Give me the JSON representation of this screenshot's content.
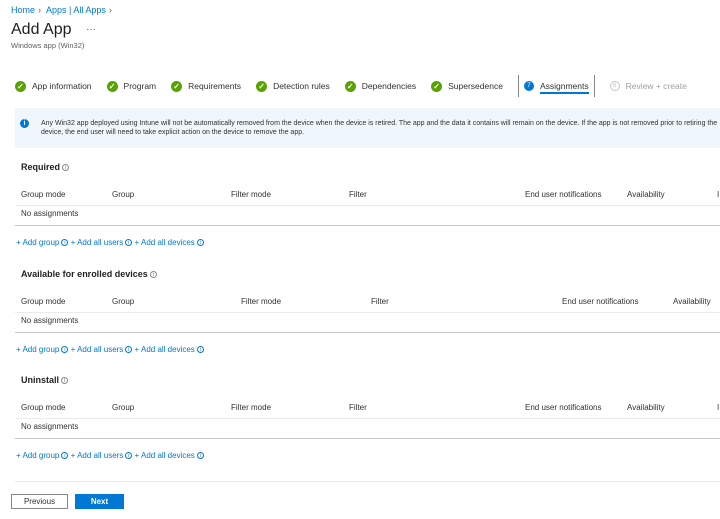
{
  "breadcrumb": [
    "Home",
    "Apps | All Apps"
  ],
  "title": "Add App",
  "more": "···",
  "subtitle": "Windows app (Win32)",
  "steps": [
    {
      "label": "App information",
      "state": "done"
    },
    {
      "label": "Program",
      "state": "done"
    },
    {
      "label": "Requirements",
      "state": "done"
    },
    {
      "label": "Detection rules",
      "state": "done"
    },
    {
      "label": "Dependencies",
      "state": "done"
    },
    {
      "label": "Supersedence",
      "state": "done"
    },
    {
      "label": "Assignments",
      "state": "current",
      "number": "7"
    },
    {
      "label": "Review + create",
      "state": "disabled",
      "number": "8"
    }
  ],
  "info": "Any Win32 app deployed using Intune will not be automatically removed from the device when the device is retired. The app and the data it contains will remain on the device. If the app is not removed prior to retiring the device, the end user will need to take explicit action on the device to remove the app.",
  "sections": [
    {
      "title": "Required",
      "columns": [
        "Group mode",
        "Group",
        "Filter mode",
        "Filter",
        "End user notifications",
        "Availability",
        "I"
      ],
      "empty": "No assignments",
      "links": [
        "+ Add group",
        "+ Add all users",
        "+ Add all devices"
      ]
    },
    {
      "title": "Available for enrolled devices",
      "columns": [
        "Group mode",
        "Group",
        "Filter mode",
        "Filter",
        "End user notifications",
        "Availability"
      ],
      "empty": "No assignments",
      "links": [
        "+ Add group",
        "+ Add all users",
        "+ Add all devices"
      ]
    },
    {
      "title": "Uninstall",
      "columns": [
        "Group mode",
        "Group",
        "Filter mode",
        "Filter",
        "End user notifications",
        "Availability",
        "I"
      ],
      "empty": "No assignments",
      "links": [
        "+ Add group",
        "+ Add all users",
        "+ Add all devices"
      ]
    }
  ],
  "footer": {
    "previous": "Previous",
    "next": "Next"
  },
  "colors": {
    "accent": "#0078d4",
    "success": "#57a300",
    "info_bg": "#eff6fc"
  }
}
